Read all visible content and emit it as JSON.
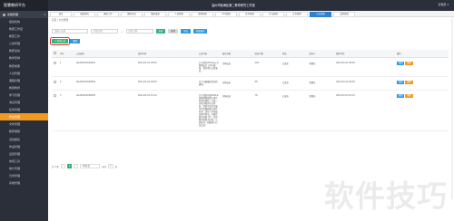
{
  "app": {
    "brand": "智慧教研平台",
    "header_title": "温州市瓯海区第二教育研究工作室",
    "user": "管理员 ▾"
  },
  "sidebar": {
    "groups": [
      {
        "label": "系统管理",
        "open": true
      },
      {
        "label": "消息管理",
        "open": false
      },
      {
        "label": "统计管理",
        "open": false
      }
    ],
    "items": [
      {
        "label": "组织机构"
      },
      {
        "label": "教研工作室"
      },
      {
        "label": "教研工作"
      },
      {
        "label": "公告管理"
      },
      {
        "label": "教研活动"
      },
      {
        "label": "教学安排"
      },
      {
        "label": "教研成果"
      },
      {
        "label": "人员管理"
      },
      {
        "label": "课程管理"
      },
      {
        "label": "教研教师"
      },
      {
        "label": "学习管理"
      },
      {
        "label": "消息管理"
      },
      {
        "label": "任务管理"
      },
      {
        "label": "作业管理"
      },
      {
        "label": "文件管理"
      },
      {
        "label": "教研课题"
      },
      {
        "label": "活动报名"
      },
      {
        "label": "作品管理"
      },
      {
        "label": "设置管理"
      },
      {
        "label": "常用工具"
      },
      {
        "label": "统计管理"
      },
      {
        "label": "日志管理"
      },
      {
        "label": "系统管理"
      }
    ]
  },
  "tabs": [
    {
      "label": "首页"
    },
    {
      "label": "组织机构"
    },
    {
      "label": "教研工作"
    },
    {
      "label": "教研活动"
    },
    {
      "label": "教研成果"
    },
    {
      "label": "人员管理"
    },
    {
      "label": "课程管理"
    },
    {
      "label": "学习管理"
    },
    {
      "label": "任务管理"
    },
    {
      "label": "作业管理"
    },
    {
      "label": "文件管理"
    },
    {
      "label": "公告管理"
    },
    {
      "label": "设置管理"
    }
  ],
  "breadcrumb": "首页 / 公告管理",
  "filters": {
    "title_placeholder": "请输入标题",
    "date_start": "开始日期",
    "date_sep": "~",
    "date_end": "结束日期",
    "btn_search": "查询",
    "btn_reset": "重置",
    "btn_export": "导出",
    "btn_batch": "批量操作"
  },
  "actions": {
    "add": "+ 新增公告",
    "delete": "删除"
  },
  "table": {
    "headers": [
      "",
      "序号",
      "公告编号",
      "发布时间",
      "公告内容",
      "发布对象",
      "阅读人数",
      "状态",
      "发布人",
      "操作时间",
      "操作"
    ],
    "rows": [
      {
        "no": "1",
        "code": "GG202101010001",
        "time": "2021-01-01 08:00",
        "content": "关于做好2021年元旦假期安全工作的通知，请各单位认真落实。",
        "target": "全体成员",
        "readers": "120",
        "status": "已发布",
        "publisher": "管理员",
        "optime": "2021-01-01 08:00",
        "op1": "编辑",
        "op2": "删除"
      },
      {
        "no": "2",
        "code": "GG202101020002",
        "time": "2021-01-02 09:30",
        "content": "关于开展教研活动的通知。",
        "target": "全体成员",
        "readers": "98",
        "status": "已发布",
        "publisher": "管理员",
        "optime": "2021-01-02 09:30",
        "op1": "编辑",
        "op2": "删除"
      },
      {
        "no": "3",
        "code": "GG202101030003",
        "time": "2021-01-03 10:15",
        "content": "关于组织开展2021年度教师教研能力提升培训的通知：为进一步提升教师专业素养，经研究决定开展本年度教研能力提升培训，请各工作室成员按时参加，并做好相关准备工作，培训期间请遵守纪律，认真听讲，积极参与讨论交流。",
        "target": "全体成员",
        "readers": "76",
        "status": "已发布",
        "publisher": "管理员",
        "optime": "2021-01-03 10:15",
        "op1": "编辑",
        "op2": "删除"
      }
    ]
  },
  "pager": {
    "total": "共 3 条",
    "prev": "‹",
    "page": "1",
    "next": "›",
    "size": "10条/页",
    "goto": "前往",
    "goto_value": "1",
    "page_unit": "页"
  },
  "watermark": "软件技巧"
}
